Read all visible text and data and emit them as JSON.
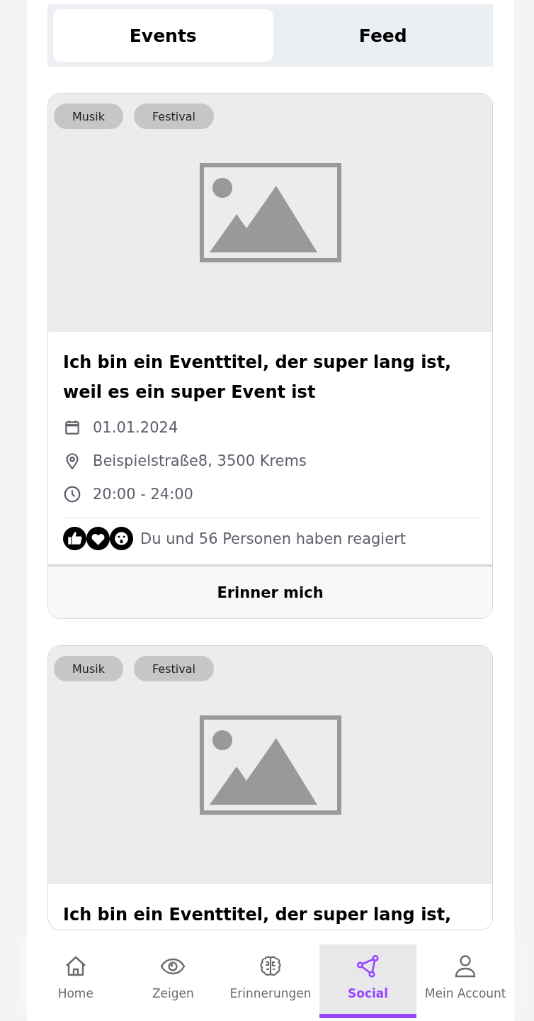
{
  "tabs": [
    {
      "label": "Events",
      "selected": true
    },
    {
      "label": "Feed",
      "selected": false
    }
  ],
  "events": [
    {
      "tags": [
        "Musik",
        "Festival"
      ],
      "title": "Ich bin ein Eventtitel, der super lang ist, weil es ein super Event ist",
      "details": [
        {
          "kind": "date",
          "text": "01.01.2024"
        },
        {
          "kind": "location",
          "text": "Beispielstraße8, 3500 Krems"
        },
        {
          "kind": "time",
          "text": "20:00 - 24:00"
        }
      ],
      "reactions": [
        {
          "kind": "like"
        },
        {
          "kind": "love"
        },
        {
          "kind": "wow"
        }
      ],
      "reaction_text": "Du und 56 Personen haben reagiert",
      "button": "Erinner mich"
    },
    {
      "tags": [
        "Musik",
        "Festival"
      ],
      "title": "Ich bin ein Eventtitel, der super lang ist,"
    }
  ],
  "bottom_nav": [
    {
      "kind": "home",
      "label": "Home",
      "selected": false
    },
    {
      "kind": "eye",
      "label": "Zeigen",
      "selected": false
    },
    {
      "kind": "brain",
      "label": "Erinnerungen",
      "selected": false
    },
    {
      "kind": "share",
      "label": "Social",
      "selected": true
    },
    {
      "kind": "user",
      "label": "Mein Account",
      "selected": false
    }
  ]
}
